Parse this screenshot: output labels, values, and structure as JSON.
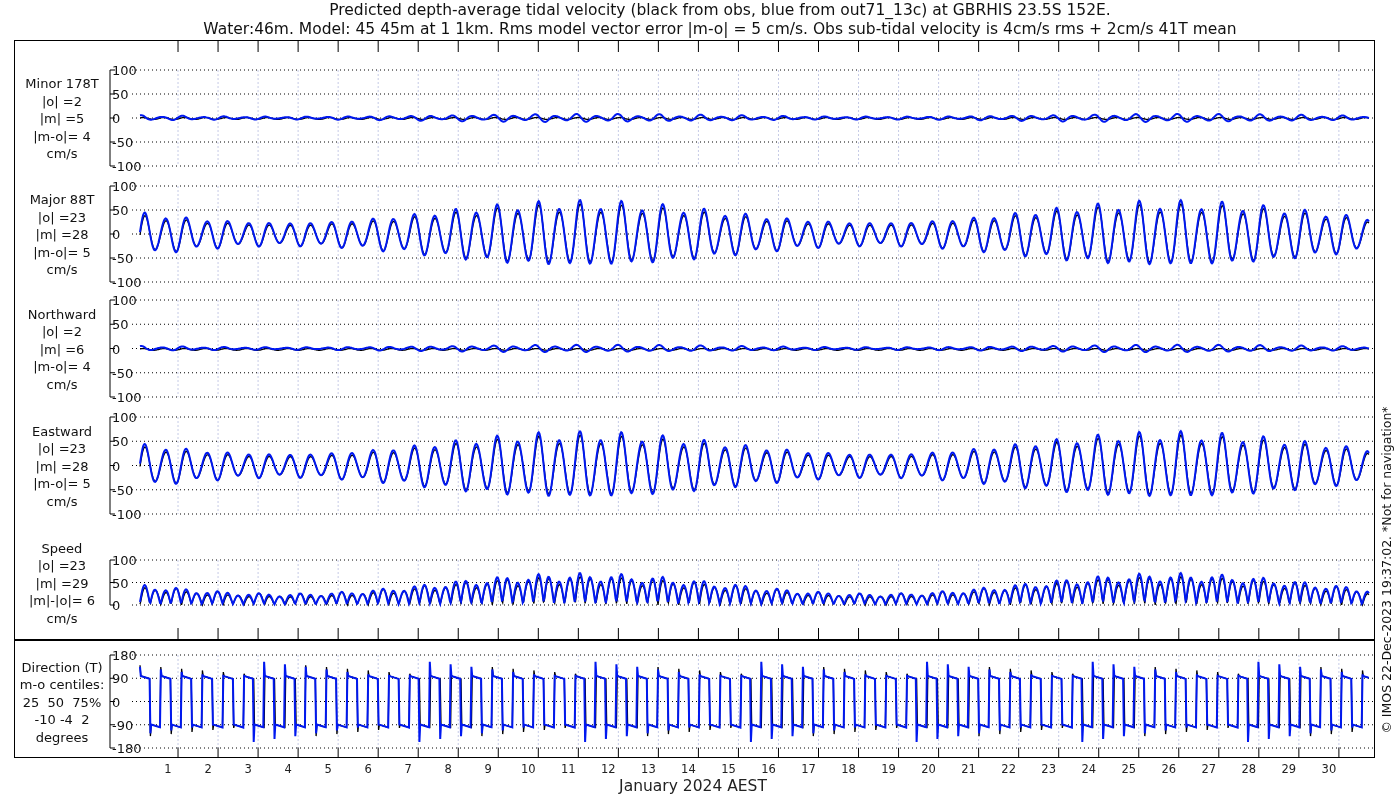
{
  "title": [
    "Predicted depth-average tidal velocity (black from obs, blue from out71_13c) at GBRHIS 23.5S 152E.",
    "Water:46m. Model: 45 45m at 1 1km. Rms model vector error |m-o| = 5 cm/s. Obs sub-tidal velocity is 4cm/s rms + 2cm/s 41T mean"
  ],
  "panels": [
    {
      "kind": "minor",
      "label": [
        "Minor 178T",
        "|o| =2",
        "|m| =5",
        "|m-o|= 4",
        "cm/s"
      ],
      "yticks": [
        "100",
        "50",
        "0",
        "-50",
        "-100"
      ]
    },
    {
      "kind": "major",
      "label": [
        "Major 88T",
        "|o| =23",
        "|m| =28",
        "|m-o|= 5",
        "cm/s"
      ],
      "yticks": [
        "100",
        "50",
        "0",
        "-50",
        "-100"
      ]
    },
    {
      "kind": "northward",
      "label": [
        "Northward",
        "|o| =2",
        "|m| =6",
        "|m-o|= 4",
        "cm/s"
      ],
      "yticks": [
        "100",
        "50",
        "0",
        "-50",
        "-100"
      ]
    },
    {
      "kind": "eastward",
      "label": [
        "Eastward",
        "|o| =23",
        "|m| =28",
        "|m-o|= 5",
        "cm/s"
      ],
      "yticks": [
        "100",
        "50",
        "0",
        "-50",
        "-100"
      ]
    },
    {
      "kind": "speed",
      "label": [
        "Speed",
        "|o| =23",
        "|m| =29",
        "|m|-|o|= 6",
        "cm/s"
      ],
      "yticks": [
        "100",
        "50",
        "0"
      ]
    },
    {
      "kind": "direction",
      "label": [
        "Direction (T)",
        "m-o centiles:",
        "25  50  75%",
        "-10 -4  2",
        "degrees"
      ],
      "yticks": [
        "180",
        "90",
        "0",
        "-90",
        "-180"
      ]
    }
  ],
  "x_axis": {
    "labels": [
      "1",
      "2",
      "3",
      "4",
      "5",
      "6",
      "7",
      "8",
      "9",
      "10",
      "11",
      "12",
      "13",
      "14",
      "15",
      "16",
      "17",
      "18",
      "19",
      "20",
      "21",
      "22",
      "23",
      "24",
      "25",
      "26",
      "27",
      "28",
      "29",
      "30"
    ],
    "title": "January 2024 AEST"
  },
  "credit": "© IMOS 22-Dec-2023 19:37:02. *Not for navigation*"
}
